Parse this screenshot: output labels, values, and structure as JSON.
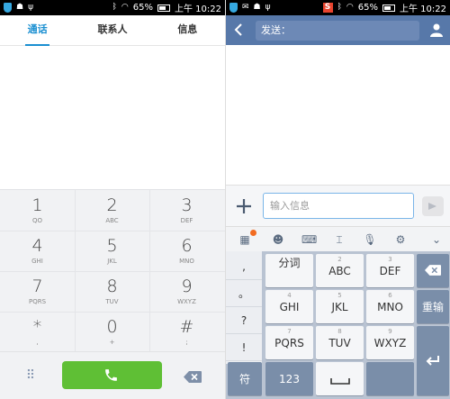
{
  "status": {
    "battery_pct": "65%",
    "time": "上午 10:22"
  },
  "dialer": {
    "tabs": [
      {
        "label": "通话",
        "active": true
      },
      {
        "label": "联系人",
        "active": false
      },
      {
        "label": "信息",
        "active": false
      }
    ],
    "keys": [
      {
        "digit": "1",
        "sub": "QO"
      },
      {
        "digit": "2",
        "sub": "ABC"
      },
      {
        "digit": "3",
        "sub": "DEF"
      },
      {
        "digit": "4",
        "sub": "GHI"
      },
      {
        "digit": "5",
        "sub": "JKL"
      },
      {
        "digit": "6",
        "sub": "MNO"
      },
      {
        "digit": "7",
        "sub": "PQRS"
      },
      {
        "digit": "8",
        "sub": "TUV"
      },
      {
        "digit": "9",
        "sub": "WXYZ"
      },
      {
        "digit": "*",
        "sub": ","
      },
      {
        "digit": "0",
        "sub": "+"
      },
      {
        "digit": "#",
        "sub": ";"
      }
    ],
    "colors": {
      "call_green": "#5fbf35",
      "tab_accent": "#1a8fd1"
    }
  },
  "messaging": {
    "recipient_label": "发送：",
    "input_placeholder": "输入信息",
    "header_color": "#5778a9",
    "ime_tools": [
      "grid-icon",
      "emoji-icon",
      "keyboard-icon",
      "cursor-icon",
      "mic-icon",
      "gear-icon",
      "chevron-down-icon"
    ],
    "side_symbols": [
      ",",
      "。",
      "?",
      "!"
    ],
    "keyboard_rows": [
      [
        {
          "num": "",
          "label": "分词"
        },
        {
          "num": "2",
          "label": "ABC"
        },
        {
          "num": "3",
          "label": "DEF"
        }
      ],
      [
        {
          "num": "4",
          "label": "GHI"
        },
        {
          "num": "5",
          "label": "JKL"
        },
        {
          "num": "6",
          "label": "MNO"
        }
      ],
      [
        {
          "num": "7",
          "label": "PQRS"
        },
        {
          "num": "8",
          "label": "TUV"
        },
        {
          "num": "9",
          "label": "WXYZ"
        }
      ]
    ],
    "reinput_label": "重输",
    "bottom_keys": {
      "symbol": "符",
      "numbers": "123"
    }
  }
}
